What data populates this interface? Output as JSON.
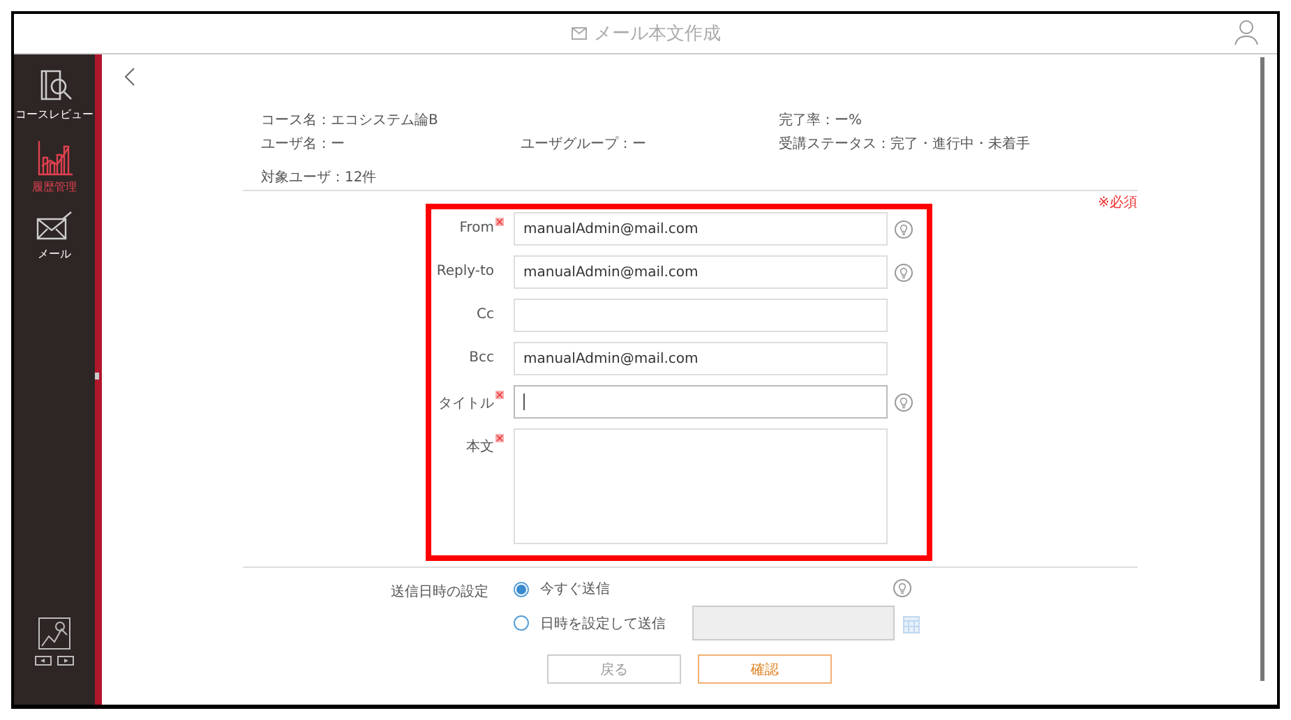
{
  "header": {
    "title": "メール本文作成"
  },
  "sidebar": {
    "items": [
      {
        "label": "コースレビュー",
        "selected": false
      },
      {
        "label": "履歴管理",
        "selected": true
      },
      {
        "label": "メール",
        "selected": false
      }
    ]
  },
  "info": {
    "course": "コース名：エコシステム論B",
    "completion": "完了率：ー%",
    "user": "ユーザ名：ー",
    "user_group": "ユーザグループ：ー",
    "status": "受講ステータス：完了・進行中・未着手",
    "target": "対象ユーザ：12件"
  },
  "required_note": "※必須",
  "form": {
    "fields": [
      {
        "label": "From",
        "kind": "input",
        "required": true,
        "value": "manualAdmin@mail.com",
        "hint": true,
        "focused": false
      },
      {
        "label": "Reply-to",
        "kind": "input",
        "required": false,
        "value": "manualAdmin@mail.com",
        "hint": true,
        "focused": false
      },
      {
        "label": "Cc",
        "kind": "input",
        "required": false,
        "hint": false,
        "focused": false
      },
      {
        "label": "Bcc",
        "kind": "input",
        "required": false,
        "value": "manualAdmin@mail.com",
        "hint": false,
        "focused": false
      },
      {
        "label": "タイトル",
        "kind": "input",
        "required": true,
        "hint": true,
        "focused": true
      },
      {
        "label": "本文",
        "kind": "textarea",
        "required": true,
        "hint": false,
        "focused": false
      }
    ]
  },
  "schedule": {
    "label": "送信日時の設定",
    "options": [
      {
        "label": "今すぐ送信",
        "selected": true
      },
      {
        "label": "日時を設定して送信",
        "selected": false
      }
    ],
    "date_field": {
      "disabled": true
    }
  },
  "buttons": [
    {
      "label": "戻る",
      "disabled": true
    },
    {
      "label": "確認",
      "disabled": false
    }
  ]
}
